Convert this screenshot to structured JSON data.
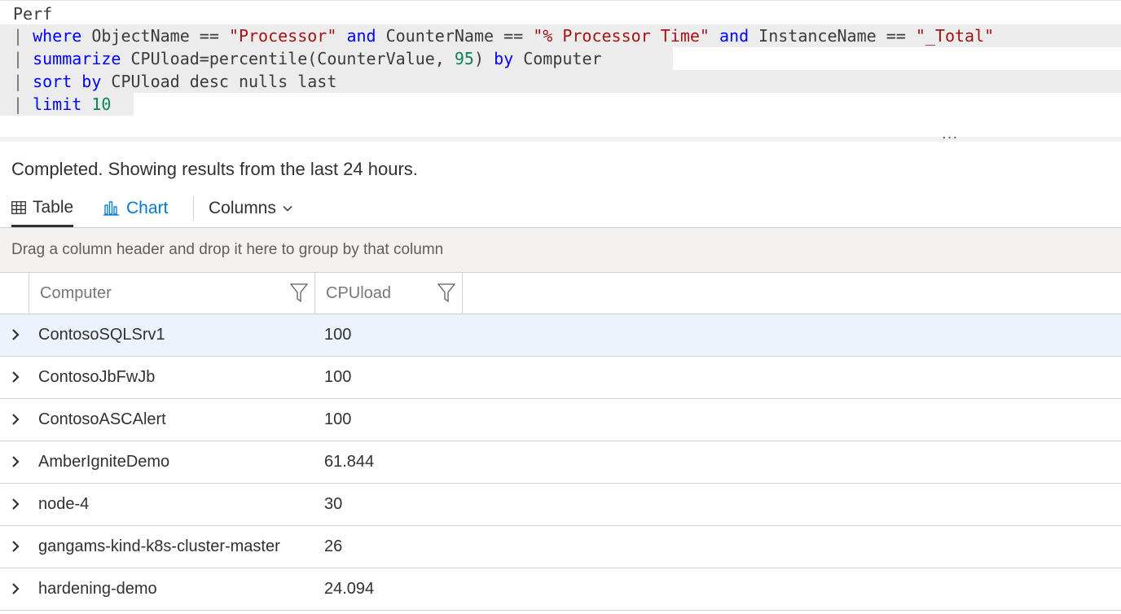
{
  "query": {
    "line1": "Perf",
    "line2": [
      {
        "t": "| ",
        "c": "pipe"
      },
      {
        "t": "where",
        "c": "kw"
      },
      {
        "t": " ObjectName == ",
        "c": "plain"
      },
      {
        "t": "\"Processor\"",
        "c": "str"
      },
      {
        "t": " ",
        "c": "plain"
      },
      {
        "t": "and",
        "c": "kw"
      },
      {
        "t": " CounterName == ",
        "c": "plain"
      },
      {
        "t": "\"% Processor Time\"",
        "c": "str"
      },
      {
        "t": " ",
        "c": "plain"
      },
      {
        "t": "and",
        "c": "kw"
      },
      {
        "t": " InstanceName == ",
        "c": "plain"
      },
      {
        "t": "\"_Total\"",
        "c": "str"
      }
    ],
    "line3": [
      {
        "t": "| ",
        "c": "pipe"
      },
      {
        "t": "summarize",
        "c": "kw"
      },
      {
        "t": " CPUload=percentile(CounterValue, ",
        "c": "plain"
      },
      {
        "t": "95",
        "c": "num"
      },
      {
        "t": ") ",
        "c": "plain"
      },
      {
        "t": "by",
        "c": "kw"
      },
      {
        "t": " Computer",
        "c": "plain"
      }
    ],
    "line4": [
      {
        "t": "| ",
        "c": "pipe"
      },
      {
        "t": "sort by",
        "c": "kw"
      },
      {
        "t": " CPUload desc nulls last ",
        "c": "plain"
      }
    ],
    "line5": [
      {
        "t": "| ",
        "c": "pipe"
      },
      {
        "t": "limit",
        "c": "kw"
      },
      {
        "t": " ",
        "c": "plain"
      },
      {
        "t": "10",
        "c": "num"
      },
      {
        "t": " ",
        "c": "plain"
      }
    ]
  },
  "more_label": "...",
  "status": "Completed. Showing results from the last 24 hours.",
  "tabs": {
    "table": "Table",
    "chart": "Chart",
    "columns": "Columns"
  },
  "group_hint": "Drag a column header and drop it here to group by that column",
  "columns": [
    "Computer",
    "CPUload"
  ],
  "rows": [
    {
      "computer": "ContosoSQLSrv1",
      "cpuload": "100",
      "selected": true
    },
    {
      "computer": "ContosoJbFwJb",
      "cpuload": "100"
    },
    {
      "computer": "ContosoASCAlert",
      "cpuload": "100"
    },
    {
      "computer": "AmberIgniteDemo",
      "cpuload": "61.844"
    },
    {
      "computer": "node-4",
      "cpuload": "30"
    },
    {
      "computer": "gangams-kind-k8s-cluster-master",
      "cpuload": "26"
    },
    {
      "computer": "hardening-demo",
      "cpuload": "24.094"
    }
  ],
  "colors": {
    "accent": "#0078d4",
    "keyword": "#0000ff",
    "string": "#a31515",
    "number": "#098658",
    "selected_row": "#ebf3fc"
  },
  "icons": {
    "table_tab": "table-grid-icon",
    "chart_tab": "bar-chart-icon",
    "columns_dropdown": "chevron-down-icon",
    "column_filter": "filter-icon",
    "row_expand": "chevron-right-icon"
  }
}
